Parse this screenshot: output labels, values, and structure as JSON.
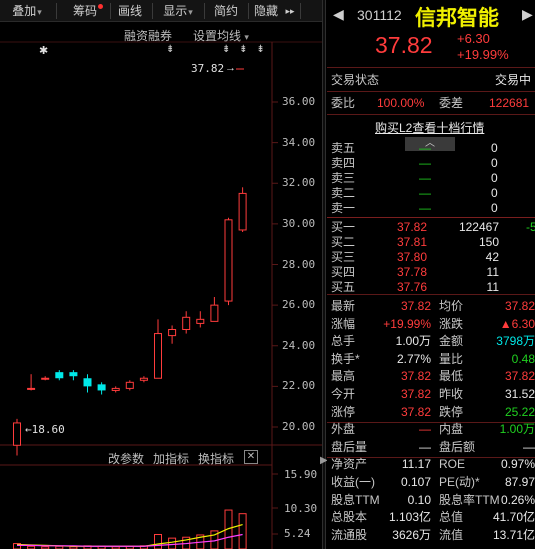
{
  "toolbar": {
    "items": [
      {
        "label": "叠加",
        "caret": true
      },
      {
        "label": "筹码",
        "dot": true
      },
      {
        "label": "画线"
      },
      {
        "label": "显示",
        "caret": true
      },
      {
        "label": "简约"
      },
      {
        "label": "隐藏"
      }
    ],
    "more": "▸▸"
  },
  "chart_top": {
    "margin_link": "融资融券",
    "ma_link": "设置均线",
    "ma_caret": "▾",
    "price_marker": "37.82",
    "low_marker": "18.60",
    "star_top": "✱",
    "arrows": "⇟ ⇟ ⇟"
  },
  "chart_data": {
    "type": "candlestick",
    "y_ticks": [
      "36.00",
      "34.00",
      "32.00",
      "30.00",
      "28.00",
      "26.00",
      "24.00",
      "22.00",
      "20.00"
    ],
    "ylim": [
      18.0,
      37.5
    ],
    "candles": [
      {
        "o": 19.1,
        "h": 20.4,
        "l": 18.6,
        "c": 20.2,
        "kind": "up"
      },
      {
        "o": 21.9,
        "h": 22.6,
        "l": 21.8,
        "c": 21.9,
        "kind": "up"
      },
      {
        "o": 22.4,
        "h": 22.5,
        "l": 22.3,
        "c": 22.4,
        "kind": "up"
      },
      {
        "o": 22.7,
        "h": 22.8,
        "l": 22.3,
        "c": 22.4,
        "kind": "cyan"
      },
      {
        "o": 22.5,
        "h": 22.8,
        "l": 22.3,
        "c": 22.7,
        "kind": "cyan"
      },
      {
        "o": 22.4,
        "h": 22.6,
        "l": 21.7,
        "c": 22.0,
        "kind": "cyan"
      },
      {
        "o": 22.1,
        "h": 22.2,
        "l": 21.6,
        "c": 21.8,
        "kind": "cyan"
      },
      {
        "o": 21.9,
        "h": 22.0,
        "l": 21.7,
        "c": 21.8,
        "kind": "up"
      },
      {
        "o": 21.9,
        "h": 22.3,
        "l": 21.8,
        "c": 22.2,
        "kind": "up"
      },
      {
        "o": 22.3,
        "h": 22.5,
        "l": 22.2,
        "c": 22.4,
        "kind": "up"
      },
      {
        "o": 22.4,
        "h": 25.3,
        "l": 22.4,
        "c": 24.6,
        "kind": "up"
      },
      {
        "o": 24.5,
        "h": 25.0,
        "l": 24.1,
        "c": 24.8,
        "kind": "up"
      },
      {
        "o": 24.8,
        "h": 25.7,
        "l": 24.6,
        "c": 25.4,
        "kind": "up"
      },
      {
        "o": 25.1,
        "h": 25.7,
        "l": 24.9,
        "c": 25.3,
        "kind": "up"
      },
      {
        "o": 25.2,
        "h": 26.4,
        "l": 25.2,
        "c": 26.0,
        "kind": "up"
      },
      {
        "o": 26.2,
        "h": 30.3,
        "l": 26.0,
        "c": 30.2,
        "kind": "up"
      },
      {
        "o": 29.7,
        "h": 31.8,
        "l": 29.6,
        "c": 31.5,
        "kind": "up"
      }
    ],
    "volume_ticks": [
      "15.90",
      "10.30",
      "5.24"
    ]
  },
  "sub_tabs": {
    "params": "改参数",
    "add": "加指标",
    "switch": "换指标",
    "close": "✕"
  },
  "panel": {
    "code": "301112",
    "name": "信邦智能",
    "price": "37.82",
    "change": "+6.30",
    "change_pct": "+19.99%",
    "status_label": "交易状态",
    "status_value": "交易中",
    "wb_label": "委比",
    "wb_value": "100.00%",
    "wc_label": "委差",
    "wc_value": "122681",
    "l2_link": "购买L2查看十档行情",
    "asks": [
      {
        "label": "卖五",
        "price": "—",
        "vol": "0"
      },
      {
        "label": "卖四",
        "price": "—",
        "vol": "0"
      },
      {
        "label": "卖三",
        "price": "—",
        "vol": "0"
      },
      {
        "label": "卖二",
        "price": "—",
        "vol": "0"
      },
      {
        "label": "卖一",
        "price": "—",
        "vol": "0"
      }
    ],
    "bids": [
      {
        "label": "买一",
        "price": "37.82",
        "vol": "122467",
        "chg": "-5"
      },
      {
        "label": "买二",
        "price": "37.81",
        "vol": "150",
        "chg": ""
      },
      {
        "label": "买三",
        "price": "37.80",
        "vol": "42",
        "chg": ""
      },
      {
        "label": "买四",
        "price": "37.78",
        "vol": "11",
        "chg": ""
      },
      {
        "label": "买五",
        "price": "37.76",
        "vol": "11",
        "chg": ""
      }
    ],
    "stats": [
      {
        "l1": "最新",
        "v1": "37.82",
        "c1": "red",
        "l2": "均价",
        "v2": "37.82",
        "c2": "red"
      },
      {
        "l1": "涨幅",
        "v1": "+19.99%",
        "c1": "red",
        "l2": "涨跌",
        "v2": "▲6.30",
        "c2": "red"
      },
      {
        "l1": "总手",
        "v1": "1.00万",
        "c1": "white",
        "l2": "金额",
        "v2": "3798万",
        "c2": "cyan"
      },
      {
        "l1": "换手*",
        "v1": "2.77%",
        "c1": "white",
        "l2": "量比",
        "v2": "0.48",
        "c2": "green"
      },
      {
        "l1": "最高",
        "v1": "37.82",
        "c1": "red",
        "l2": "最低",
        "v2": "37.82",
        "c2": "red"
      },
      {
        "l1": "今开",
        "v1": "37.82",
        "c1": "red",
        "l2": "昨收",
        "v2": "31.52",
        "c2": "white"
      },
      {
        "l1": "涨停",
        "v1": "37.82",
        "c1": "red",
        "l2": "跌停",
        "v2": "25.22",
        "c2": "green"
      },
      {
        "l1": "外盘",
        "v1": "—",
        "c1": "red",
        "l2": "内盘",
        "v2": "1.00万",
        "c2": "green"
      },
      {
        "l1": "盘后量",
        "v1": "—",
        "c1": "white",
        "l2": "盘后额",
        "v2": "—",
        "c2": "white"
      },
      {
        "l1": "净资产",
        "v1": "11.17",
        "c1": "white",
        "l2": "ROE",
        "v2": "0.97%",
        "c2": "white"
      },
      {
        "l1": "收益(一)",
        "v1": "0.107",
        "c1": "white",
        "l2": "PE(动)*",
        "v2": "87.97",
        "c2": "white"
      },
      {
        "l1": "股息TTM",
        "v1": "0.10",
        "c1": "white",
        "l2": "股息率TTM",
        "v2": "0.26%",
        "c2": "white"
      },
      {
        "l1": "总股本",
        "v1": "1.103亿",
        "c1": "white",
        "l2": "总值",
        "v2": "41.70亿",
        "c2": "white"
      },
      {
        "l1": "流通股",
        "v1": "3626万",
        "c1": "white",
        "l2": "流值",
        "v2": "13.71亿",
        "c2": "white"
      }
    ],
    "colors": {
      "red": "#ff3c3c",
      "green": "#20d020",
      "yellow": "#f0f000",
      "cyan": "#00e8e8",
      "grid_red": "#5a1818"
    }
  }
}
